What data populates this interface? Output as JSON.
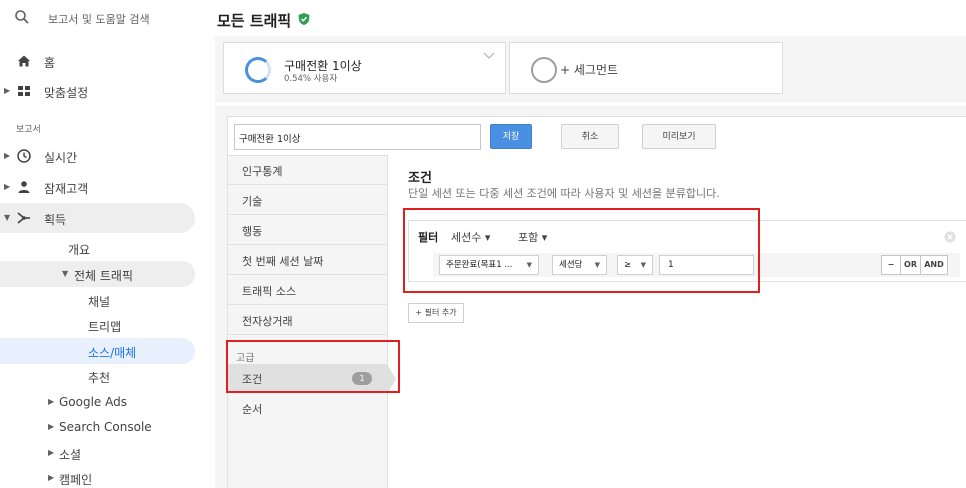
{
  "sidebar": {
    "search_text": "보고서 및 도움말 검색",
    "home": "홈",
    "customization": "맞춤설정",
    "reports_section": "보고서",
    "realtime": "실시간",
    "audience": "잠재고객",
    "acquisition": "획득",
    "overview": "개요",
    "all_traffic": "전체 트래픽",
    "channels": "채널",
    "treemaps": "트리맵",
    "source_medium": "소스/매체",
    "referrals": "추천",
    "google_ads": "Google Ads",
    "search_console": "Search Console",
    "social": "소셜",
    "campaigns": "캠페인"
  },
  "header": {
    "title": "모든 트래픽"
  },
  "segments": [
    {
      "name": "구매전환 1이상",
      "sub": "0.54% 사용자"
    },
    {
      "name": "+ 세그먼트"
    }
  ],
  "editor": {
    "name_value": "구매전환 1이상",
    "save": "저장",
    "cancel": "취소",
    "preview": "미리보기",
    "menu": {
      "demographics": "인구통계",
      "technology": "기술",
      "behavior": "행동",
      "first_session": "첫 번째 세션 날짜",
      "traffic_sources": "트래픽 소스",
      "ecommerce": "전자상거래",
      "advanced": "고급",
      "conditions": "조건",
      "conditions_count": "1",
      "sequences": "순서"
    },
    "conditions": {
      "title": "조건",
      "description": "단일 세션 또는 다중 세션 조건에 따라 사용자 및 세션을 분류합니다.",
      "filter_label": "필터",
      "scope": "세션수",
      "mode": "포함",
      "dimension": "주문완료(목표1 ...",
      "per": "세션당",
      "operator": "≥",
      "value": "1",
      "minus": "−",
      "or": "OR",
      "and": "AND",
      "add_filter": "+ 필터 추가"
    }
  },
  "colors": {
    "accent": "#4a90e2",
    "highlight": "#e02020",
    "verified": "#2e9e4f",
    "selected_nav": "#1a73e8"
  }
}
